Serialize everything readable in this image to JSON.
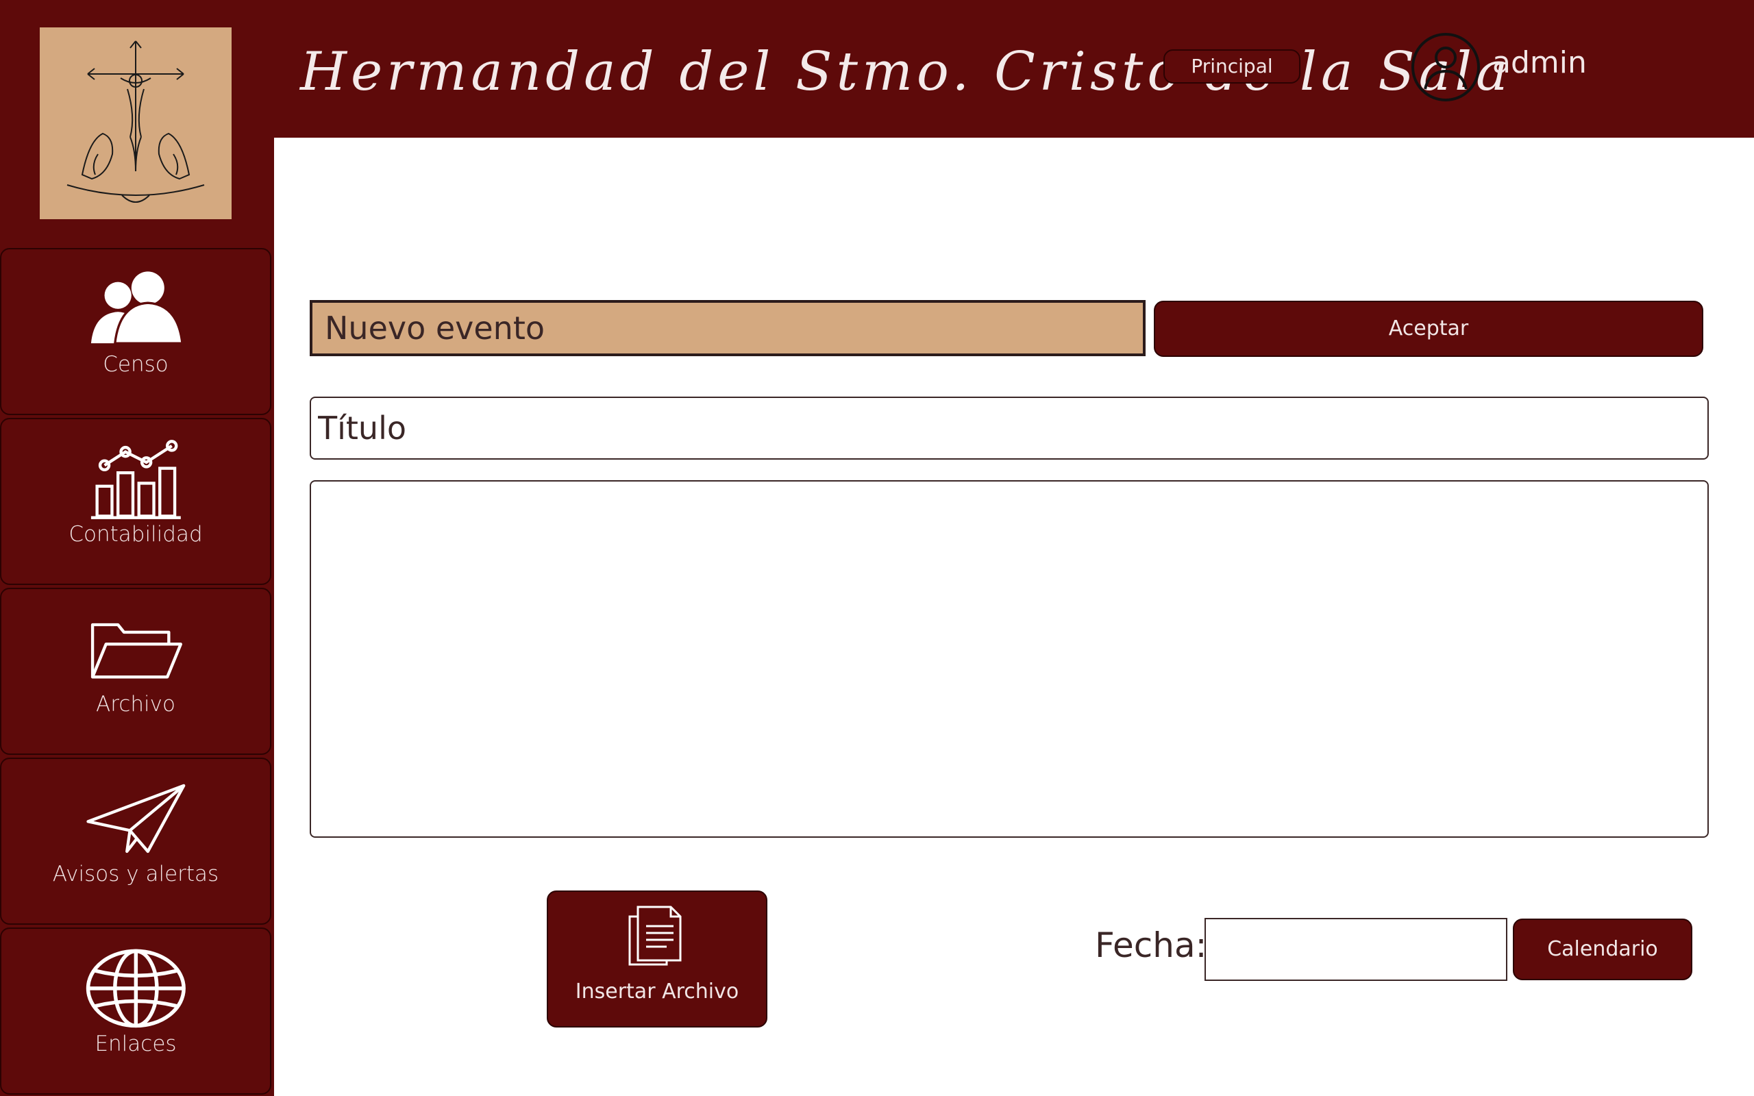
{
  "header": {
    "brand_title": "Hermandad del Stmo. Cristo de la Sala",
    "principal_label": "Principal",
    "user_name": "admin"
  },
  "sidebar": {
    "items": [
      {
        "label": "Censo",
        "icon": "users-icon"
      },
      {
        "label": "Contabilidad",
        "icon": "chart-icon"
      },
      {
        "label": "Archivo",
        "icon": "folder-icon"
      },
      {
        "label": "Avisos y alertas",
        "icon": "paper-plane-icon"
      },
      {
        "label": "Enlaces",
        "icon": "globe-icon"
      }
    ]
  },
  "form": {
    "event_label": "Nuevo evento",
    "accept_label": "Aceptar",
    "title_placeholder": "Título",
    "body_value": "",
    "insert_file_label": "Insertar Archivo",
    "date_label": "Fecha:",
    "date_value": "",
    "calendar_label": "Calendario"
  },
  "colors": {
    "primary": "#5e0a0a",
    "accent": "#d4a980",
    "text_light": "#f2e6e6",
    "panel": "#ffffff"
  }
}
